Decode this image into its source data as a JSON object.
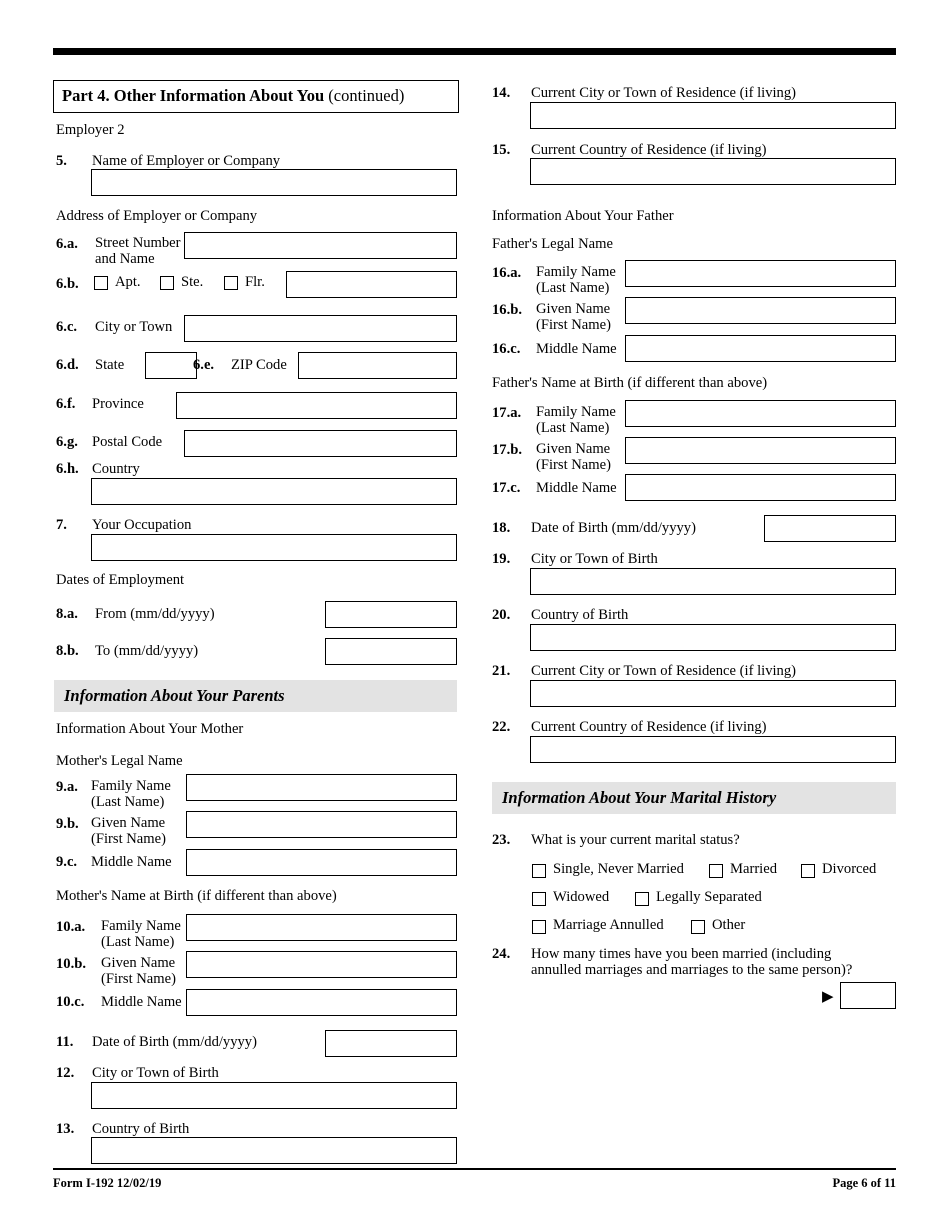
{
  "form": {
    "footer_left": "Form I-192  12/02/19",
    "footer_right": "Page 6 of 11"
  },
  "left_column": {
    "part_header": {
      "bold": "Part 4.  Other Information About You",
      "normal": "(continued)"
    },
    "employer_label": "Employer 2",
    "item5": {
      "num": "5.",
      "label": "Name of Employer or Company"
    },
    "address_label": "Address of Employer or Company",
    "item6a": {
      "num": "6.a.",
      "label_line1": "Street Number",
      "label_line2": "and Name"
    },
    "item6b": {
      "num": "6.b.",
      "apt": "Apt.",
      "ste": "Ste.",
      "flr": "Flr."
    },
    "item6c": {
      "num": "6.c.",
      "label": "City or Town"
    },
    "item6d": {
      "num": "6.d.",
      "label": "State"
    },
    "item6e": {
      "num": "6.e.",
      "label": "ZIP Code"
    },
    "item6f": {
      "num": "6.f.",
      "label": "Province"
    },
    "item6g": {
      "num": "6.g.",
      "label": "Postal Code"
    },
    "item6h": {
      "num": "6.h.",
      "label": "Country"
    },
    "item7": {
      "num": "7.",
      "label": "Your Occupation"
    },
    "dates_label": "Dates of Employment",
    "item8a": {
      "num": "8.a.",
      "label": "From (mm/dd/yyyy)"
    },
    "item8b": {
      "num": "8.b.",
      "label": "To (mm/dd/yyyy)"
    },
    "parents_header": "Information About Your Parents",
    "mother_label": "Information About Your Mother",
    "mother_legal_name": "Mother's Legal Name",
    "item9a": {
      "num": "9.a.",
      "label_line1": "Family Name",
      "label_line2": "(Last Name)"
    },
    "item9b": {
      "num": "9.b.",
      "label_line1": "Given Name",
      "label_line2": "(First Name)"
    },
    "item9c": {
      "num": "9.c.",
      "label": "Middle Name"
    },
    "mother_birth_name": "Mother's Name at Birth (if different than above)",
    "item10a": {
      "num": "10.a.",
      "label_line1": "Family Name",
      "label_line2": "(Last Name)"
    },
    "item10b": {
      "num": "10.b.",
      "label_line1": "Given Name",
      "label_line2": "(First Name)"
    },
    "item10c": {
      "num": "10.c.",
      "label": "Middle Name"
    },
    "item11": {
      "num": "11.",
      "label": "Date of Birth (mm/dd/yyyy)"
    },
    "item12": {
      "num": "12.",
      "label": "City or Town of Birth"
    },
    "item13": {
      "num": "13.",
      "label": "Country of Birth"
    }
  },
  "right_column": {
    "item14": {
      "num": "14.",
      "label": "Current City or Town of Residence (if living)"
    },
    "item15": {
      "num": "15.",
      "label": "Current Country of Residence (if living)"
    },
    "father_label": "Information About Your Father",
    "father_legal_name": "Father's Legal Name",
    "item16a": {
      "num": "16.a.",
      "label_line1": "Family Name",
      "label_line2": "(Last Name)"
    },
    "item16b": {
      "num": "16.b.",
      "label_line1": "Given Name",
      "label_line2": "(First Name)"
    },
    "item16c": {
      "num": "16.c.",
      "label": "Middle Name"
    },
    "father_birth_name": "Father's Name at Birth (if different than above)",
    "item17a": {
      "num": "17.a.",
      "label_line1": "Family Name",
      "label_line2": "(Last Name)"
    },
    "item17b": {
      "num": "17.b.",
      "label_line1": "Given Name",
      "label_line2": "(First Name)"
    },
    "item17c": {
      "num": "17.c.",
      "label": "Middle Name"
    },
    "item18": {
      "num": "18.",
      "label": "Date of Birth (mm/dd/yyyy)"
    },
    "item19": {
      "num": "19.",
      "label": "City or Town of Birth"
    },
    "item20": {
      "num": "20.",
      "label": "Country of Birth"
    },
    "item21": {
      "num": "21.",
      "label": "Current City or Town of Residence (if living)"
    },
    "item22": {
      "num": "22.",
      "label": "Current Country of Residence (if living)"
    },
    "marital_header": "Information About Your Marital History",
    "item23": {
      "num": "23.",
      "label": "What is your current marital status?",
      "options": [
        "Single, Never Married",
        "Married",
        "Divorced",
        "Widowed",
        "Legally Separated",
        "Marriage Annulled",
        "Other"
      ]
    },
    "item24": {
      "num": "24.",
      "label_line1": "How many times have you been married (including",
      "label_line2": "annulled marriages and marriages to the same person)?",
      "arrow": "▶"
    }
  }
}
